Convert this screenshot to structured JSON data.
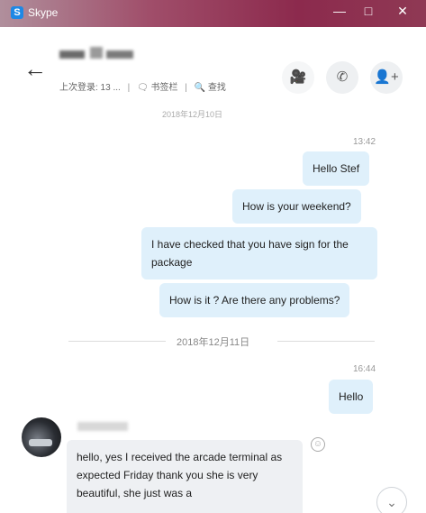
{
  "window": {
    "title": "Skype",
    "minimize": "—",
    "maximize": "□",
    "close": "✕"
  },
  "header": {
    "back": "←",
    "status_last_seen": "上次登录: 13 ...",
    "sep1": "|",
    "bookmark": "🗨 书签栏",
    "sep2": "|",
    "search": "🔍 查找",
    "video_icon": "🎥",
    "call_icon": "✆",
    "add_user_icon": "👤+"
  },
  "chat": {
    "date_top": "2018年12月10日",
    "time1": "13:42",
    "messages_out_1": [
      "Hello Stef",
      "How is your weekend?",
      "I have checked that you have sign for the package",
      "How is it ? Are there any problems?"
    ],
    "date_sep": "2018年12月11日",
    "time2": "16:44",
    "msg_hello": "Hello",
    "incoming": "hello, yes I received the arcade terminal as expected Friday thank you she is very beautiful, she just was a",
    "emoji": "☺",
    "scroll_down": "⌄"
  }
}
